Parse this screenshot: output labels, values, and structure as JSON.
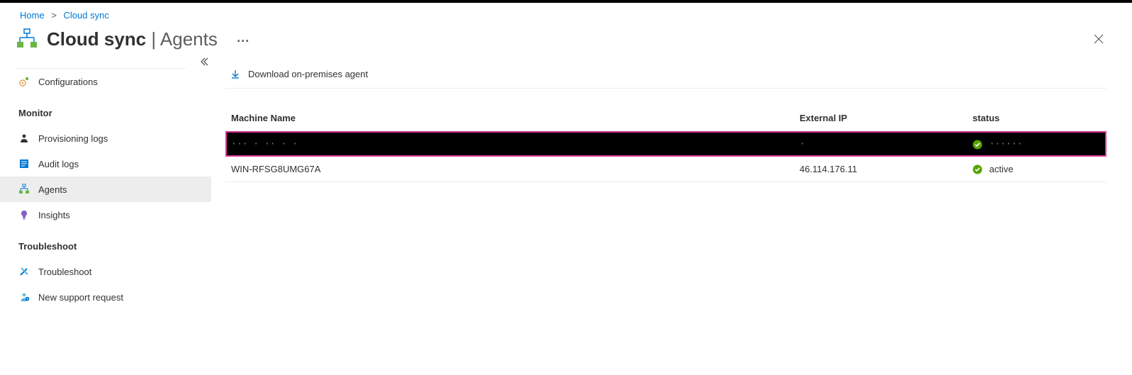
{
  "breadcrumb": {
    "home": "Home",
    "cloudsync": "Cloud sync"
  },
  "header": {
    "title_main": "Cloud sync",
    "title_sep": " | ",
    "title_sub": "Agents",
    "ellipsis": "···"
  },
  "sidebar": {
    "items": {
      "configurations": "Configurations",
      "provisioning": "Provisioning logs",
      "audit": "Audit logs",
      "agents": "Agents",
      "insights": "Insights",
      "troubleshoot_item": "Troubleshoot",
      "support": "New support request"
    },
    "headings": {
      "monitor": "Monitor",
      "troubleshoot": "Troubleshoot"
    }
  },
  "toolbar": {
    "download": "Download on-premises agent"
  },
  "table": {
    "columns": {
      "name": "Machine Name",
      "ip": "External IP",
      "status": "status"
    },
    "rows": [
      {
        "name_redacted": "··· ·  ··    ·        ·",
        "ip_redacted": "·",
        "status_redacted": "······",
        "selected": true
      },
      {
        "name": "WIN-RFSG8UMG67A",
        "ip": "46.114.176.11",
        "status": "active",
        "selected": false
      }
    ]
  }
}
